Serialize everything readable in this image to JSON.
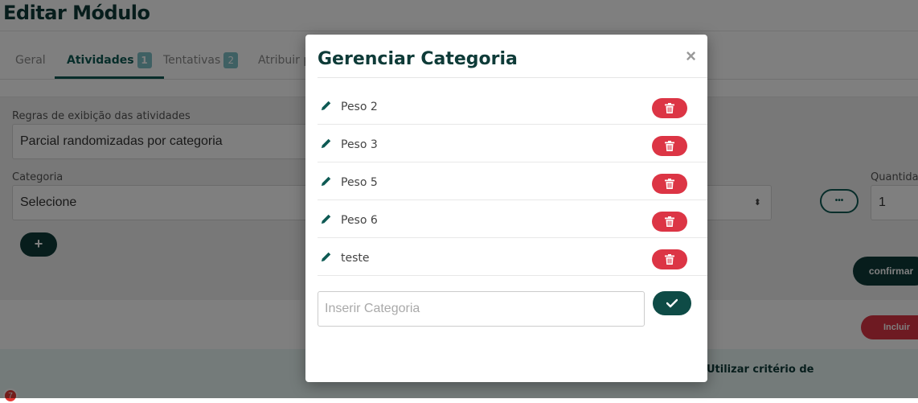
{
  "page": {
    "title": "Editar Módulo"
  },
  "tabs": [
    {
      "label": "Geral",
      "badge": ""
    },
    {
      "label": "Atividades",
      "badge": "1"
    },
    {
      "label": "Tentativas",
      "badge": "2"
    },
    {
      "label": "Atribuir p",
      "badge": ""
    }
  ],
  "form": {
    "rules_label": "Regras de exibição das atividades",
    "rules_value": "Parcial randomizadas por categoria",
    "category_label": "Categoria",
    "category_value": "Selecione",
    "quantity_label": "Quantida",
    "quantity_value": "1",
    "add_button": "+",
    "more_button": "•••",
    "confirm_button": "confirmar",
    "include_button": "Incluir"
  },
  "table": {
    "header_criteria": "Utilizar critério de"
  },
  "notification_count": "7",
  "modal": {
    "title": "Gerenciar Categoria",
    "close": "×",
    "categories": [
      "Peso 2",
      "Peso 3",
      "Peso 5",
      "Peso 6",
      "teste"
    ],
    "new_placeholder": "Inserir Categoria"
  },
  "colors": {
    "primary": "#0e3b38",
    "accent": "#0e5a54",
    "danger": "#dc3545",
    "badge": "#7ec0c7"
  }
}
